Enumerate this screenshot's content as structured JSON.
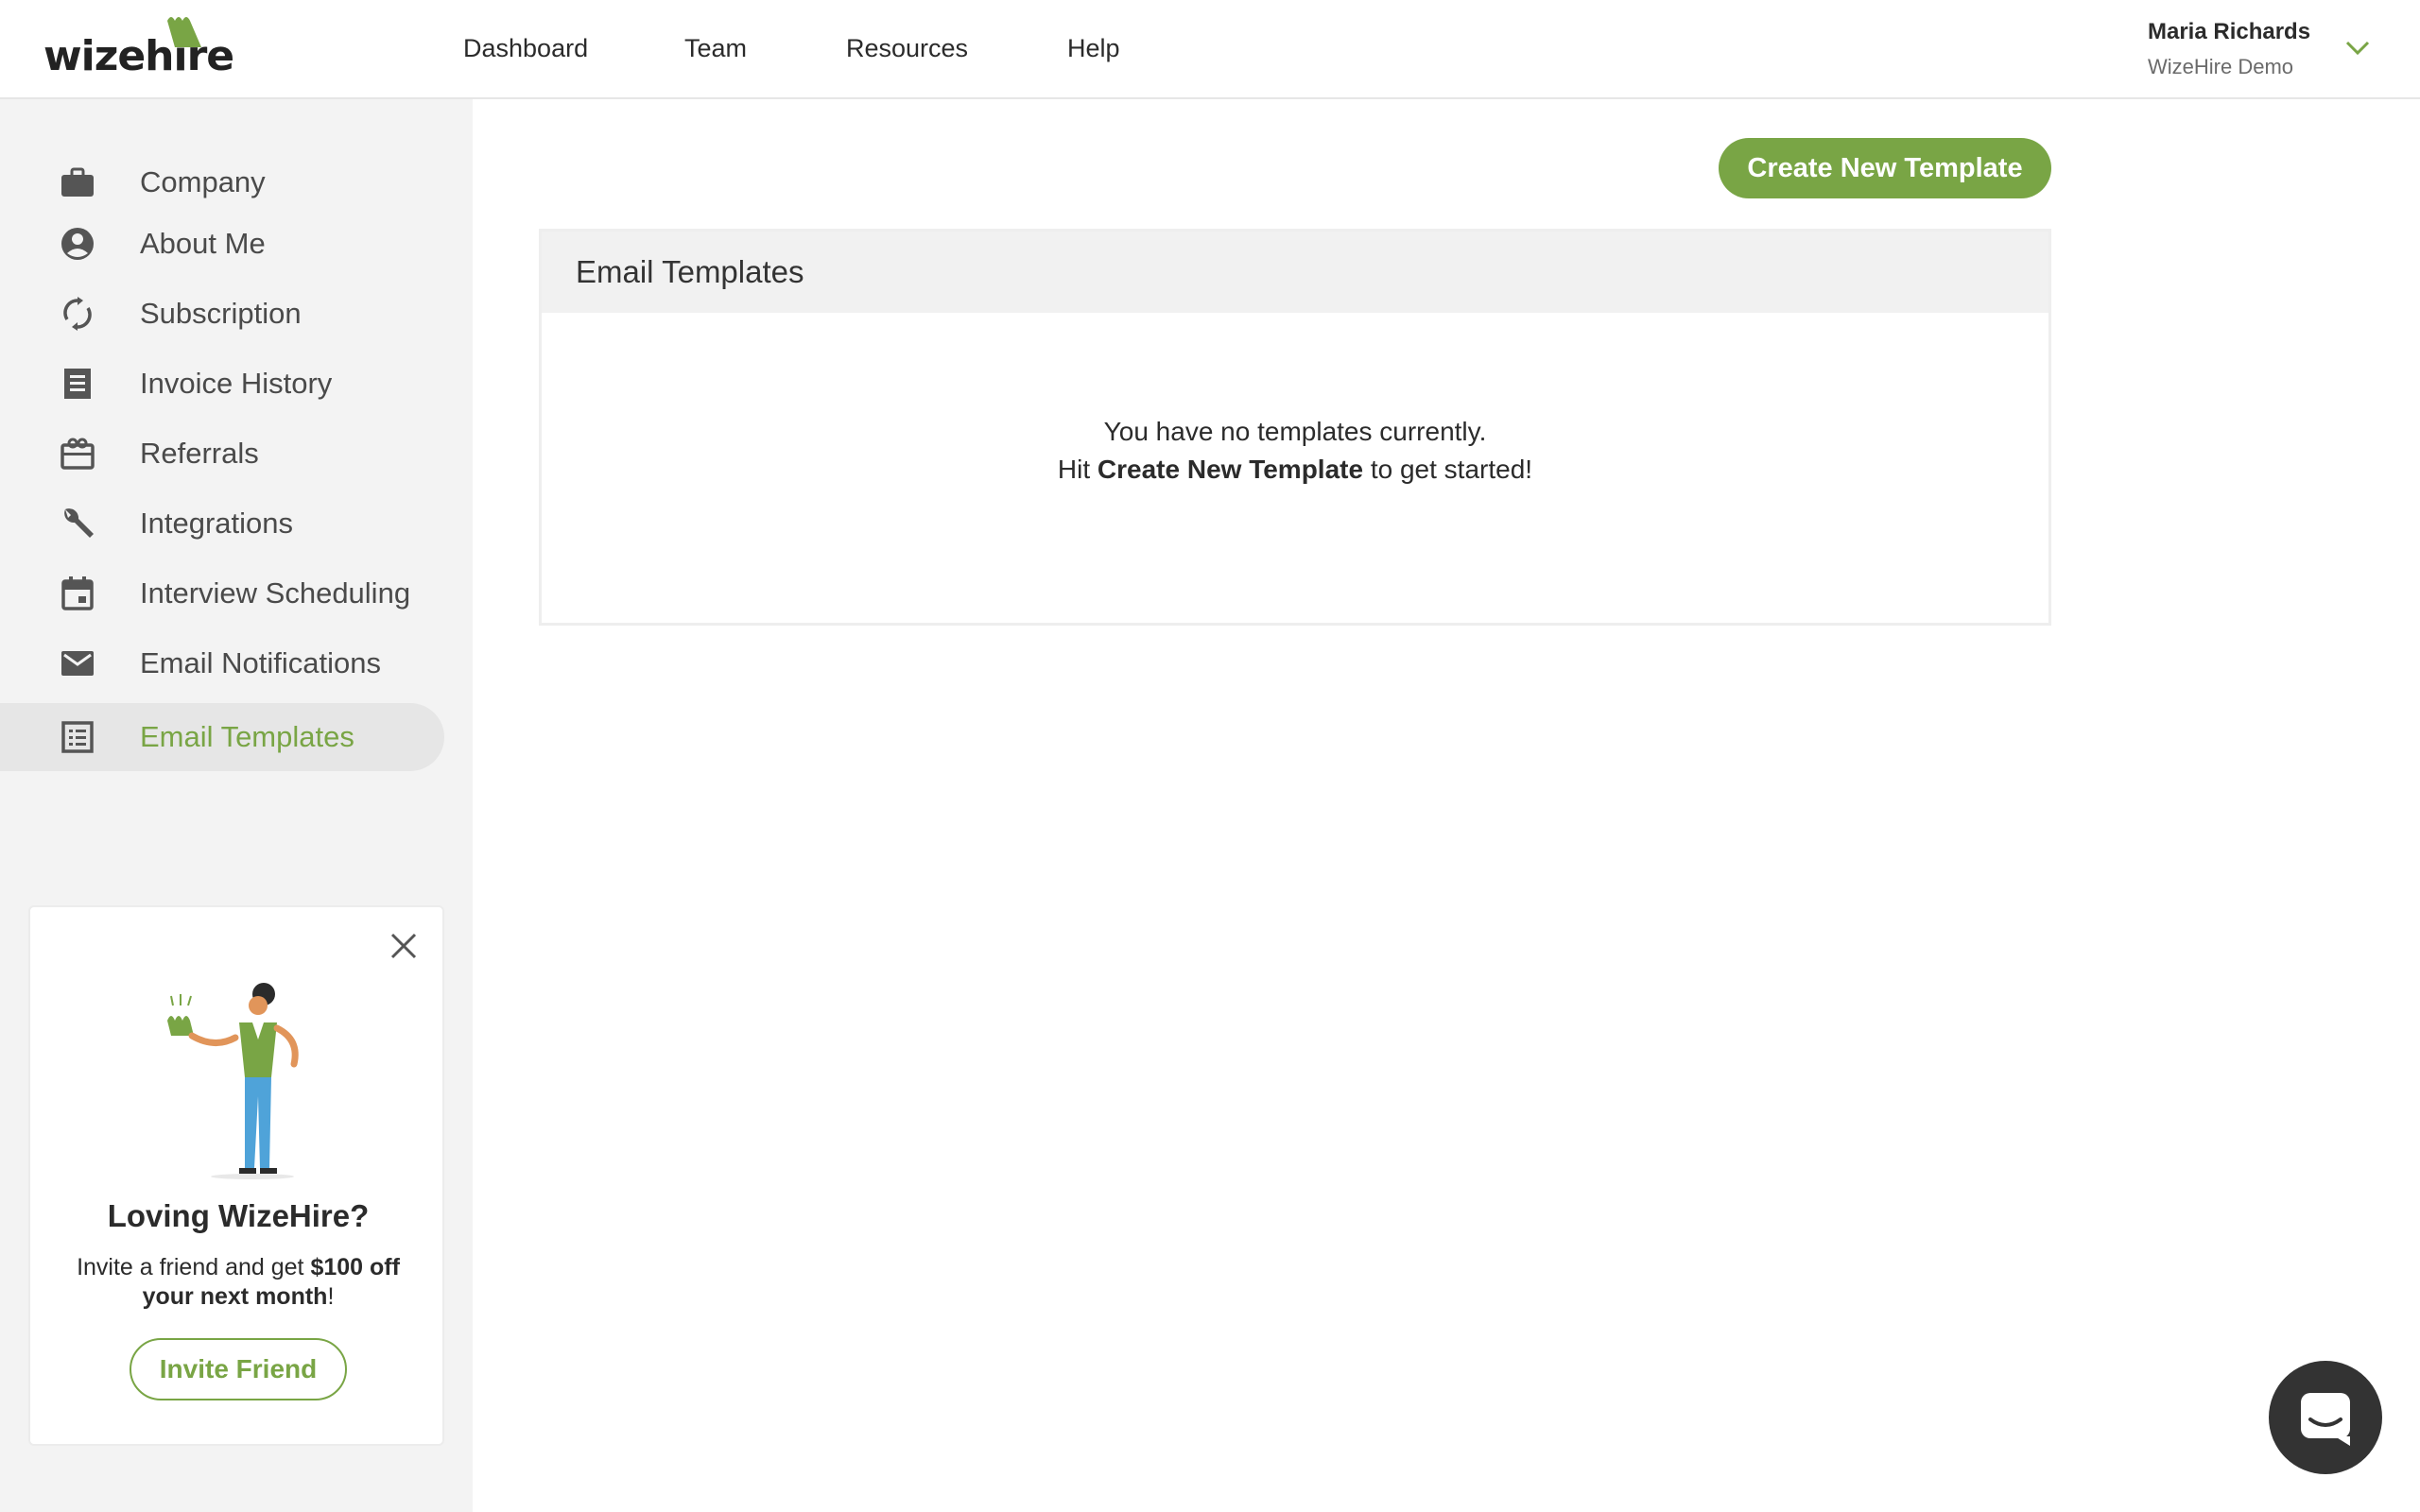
{
  "brand": {
    "logo_text": "wizehire",
    "accent": "#79a545"
  },
  "nav": {
    "items": [
      {
        "label": "Dashboard"
      },
      {
        "label": "Team"
      },
      {
        "label": "Resources"
      },
      {
        "label": "Help"
      }
    ]
  },
  "user": {
    "name": "Maria Richards",
    "org": "WizeHire Demo"
  },
  "sidebar": {
    "items": [
      {
        "label": "Company",
        "icon": "briefcase-icon"
      },
      {
        "label": "About Me",
        "icon": "account-circle-icon"
      },
      {
        "label": "Subscription",
        "icon": "sync-icon"
      },
      {
        "label": "Invoice History",
        "icon": "receipt-icon"
      },
      {
        "label": "Referrals",
        "icon": "gift-card-icon"
      },
      {
        "label": "Integrations",
        "icon": "wrench-icon"
      },
      {
        "label": "Interview Scheduling",
        "icon": "calendar-icon"
      },
      {
        "label": "Email Notifications",
        "icon": "mail-icon"
      },
      {
        "label": "Email Templates",
        "icon": "list-alt-icon",
        "active": true
      }
    ]
  },
  "promo": {
    "title": "Loving WizeHire?",
    "text_prefix": "Invite a friend and get ",
    "text_bold": "$100 off your next month",
    "text_suffix": "!",
    "button": "Invite Friend"
  },
  "main": {
    "create_button": "Create New Template",
    "panel_title": "Email Templates",
    "empty_line1": "You have no templates currently.",
    "empty_line2_prefix": "Hit ",
    "empty_line2_bold": "Create New Template",
    "empty_line2_suffix": " to get started!"
  }
}
